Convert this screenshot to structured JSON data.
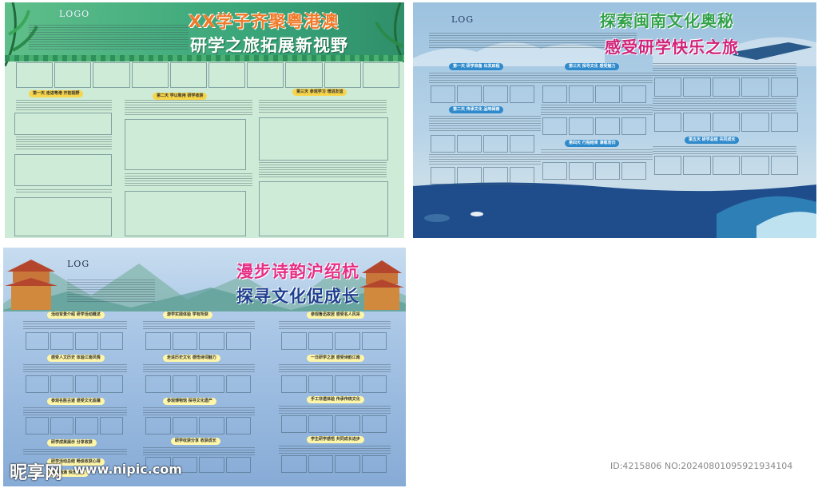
{
  "panel1": {
    "logo": "LOGO",
    "title_line1": "XX学子齐聚粤港澳",
    "title_line2": "研学之旅拓展新视野",
    "sections": [
      "第一天 走进粤港 开拓视野",
      "第二天 学以致用 研学收获",
      "第三天 参观学习 增进友谊"
    ],
    "colors": {
      "bg": "#cdebd6",
      "header": "#3aa67a",
      "title": "#f07a2a",
      "title2": "#ffffff"
    }
  },
  "panel2": {
    "logo": "LOG",
    "title_line1": "探索闽南文化奥秘",
    "title_line2": "感受研学快乐之旅",
    "sections": [
      "第一天 研学准备 出发启程",
      "第二天 传承文化 品味闽南",
      "第三天 探寻文化 感受魅力",
      "第四天 行程结束 满载而归",
      "第五天 研学总结 共同成长"
    ],
    "colors": {
      "sky": "#9cc2df",
      "sea": "#1f4d8c",
      "title1": "#32a24a",
      "title2": "#d0247a"
    }
  },
  "panel3": {
    "logo": "LOG",
    "title_line1": "漫步诗韵沪绍杭",
    "title_line2": "探寻文化促成长",
    "sections": [
      "活动背景介绍 研学活动概述",
      "感受人文历史 体验江南风情",
      "参观名胜古迹 感受文化底蕴",
      "研学成果展示 分享收获",
      "游学实践体验 学有所获",
      "走进历史文化 感悟诗词魅力",
      "参观博物馆 探寻文化遗产",
      "研学收获分享 收获成长",
      "参观鲁迅故居 感受名人风采",
      "一日研学之旅 感受诗韵江南",
      "手工非遗体验 传承传统文化",
      "学生研学感悟 共同成长进步",
      "研学活动总结 畅谈收获心得",
      "收获满满 快乐成长"
    ],
    "colors": {
      "bg": "#a9c6e6",
      "title1": "#e62e86",
      "title2": "#1e3f8f"
    }
  },
  "watermark": {
    "brand": "昵享网",
    "url": "www.nipic.com",
    "id": "ID:4215806 NO:20240801095921934104"
  }
}
